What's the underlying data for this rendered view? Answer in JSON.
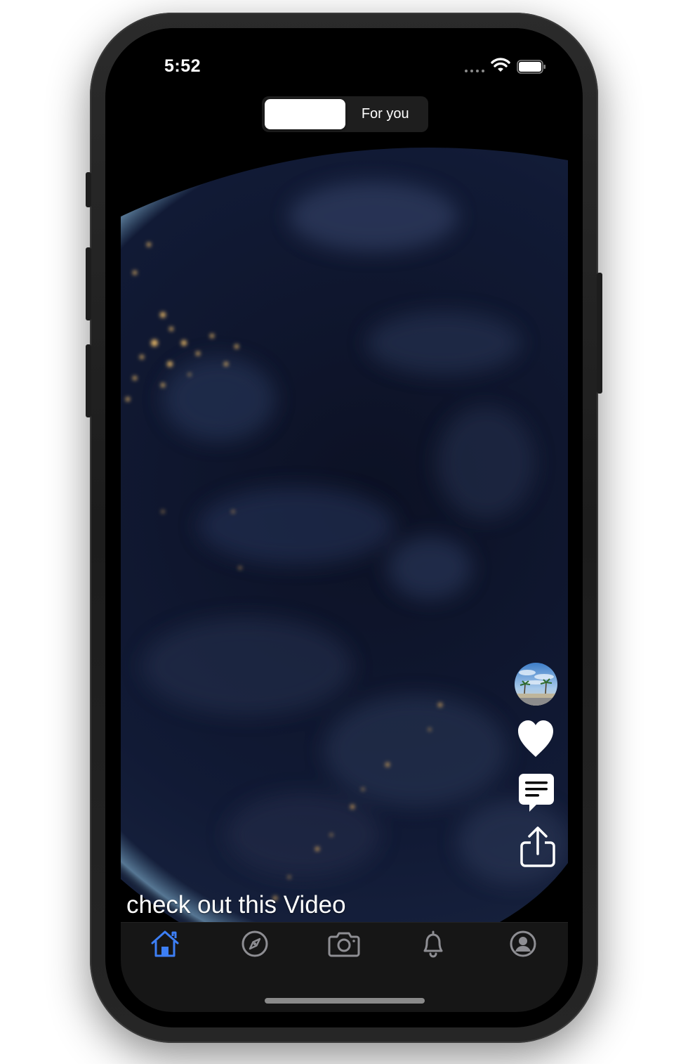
{
  "status_bar": {
    "time": "5:52"
  },
  "feed_switcher": {
    "tabs": [
      {
        "label": "",
        "selected": true
      },
      {
        "label": "For you",
        "selected": false
      }
    ]
  },
  "video": {
    "caption": "check out this Video",
    "actions": {
      "avatar": "avatar",
      "like": "heart-icon",
      "comment": "comment-icon",
      "share": "share-icon"
    }
  },
  "tab_bar": {
    "active_color": "#3d7ff5",
    "inactive_color": "#8e8e93",
    "items": [
      {
        "icon": "home-icon",
        "active": true
      },
      {
        "icon": "compass-icon",
        "active": false
      },
      {
        "icon": "camera-icon",
        "active": false
      },
      {
        "icon": "bell-icon",
        "active": false
      },
      {
        "icon": "profile-icon",
        "active": false
      }
    ]
  }
}
